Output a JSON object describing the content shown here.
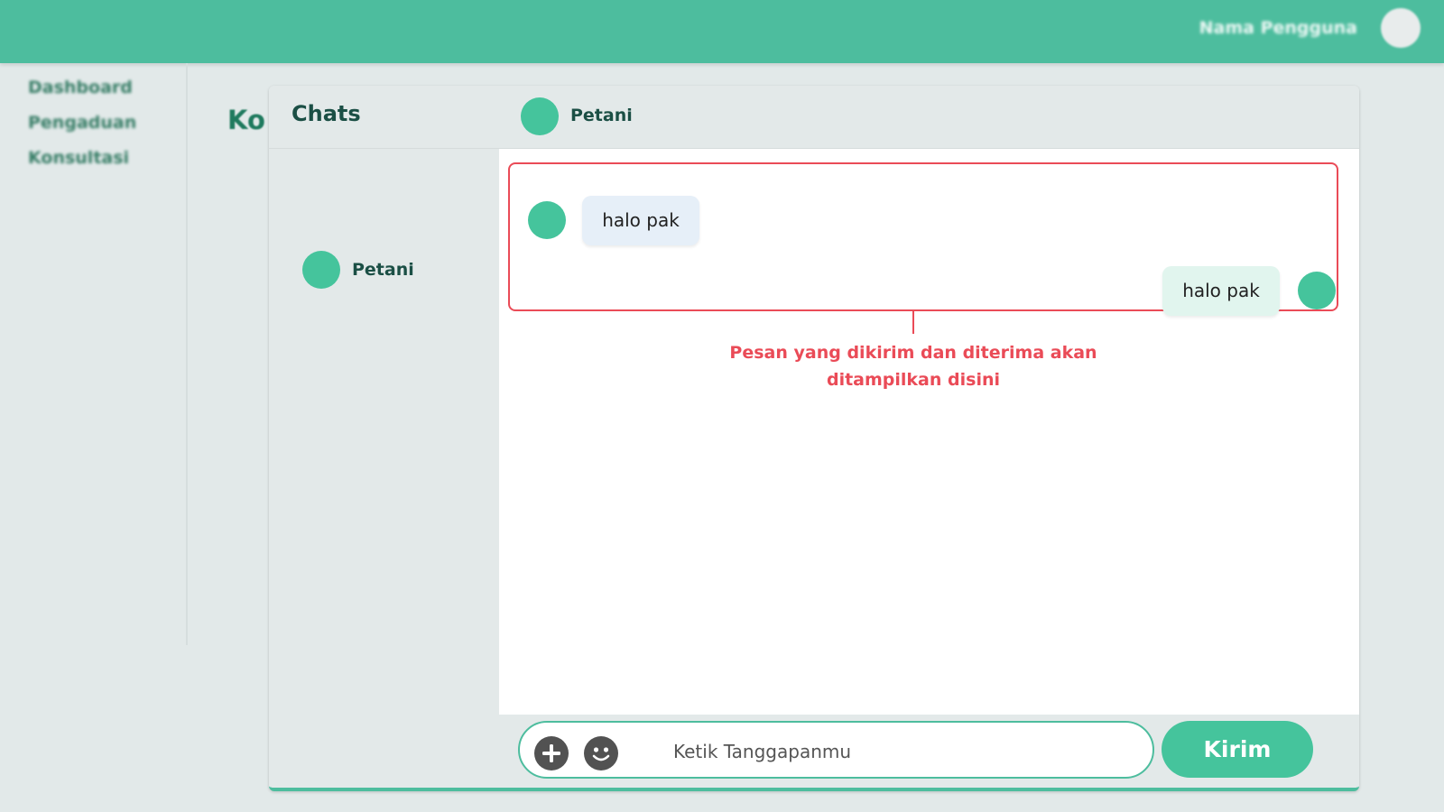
{
  "topbar": {
    "username": "Nama Pengguna"
  },
  "sidebar": {
    "items": [
      {
        "label": "Dashboard"
      },
      {
        "label": "Pengaduan"
      },
      {
        "label": "Konsultasi"
      }
    ]
  },
  "page": {
    "heading": "Konsultasi"
  },
  "chat": {
    "title": "Chats",
    "active_contact": "Petani",
    "contacts": [
      {
        "name": "Petani"
      }
    ],
    "messages": [
      {
        "direction": "incoming",
        "text": "halo pak"
      },
      {
        "direction": "outgoing",
        "text": "halo pak"
      }
    ],
    "annotation": "Pesan yang dikirim dan diterima akan ditampilkan disini",
    "input": {
      "placeholder": "Ketik Tanggapanmu",
      "value": ""
    },
    "send_label": "Kirim",
    "icons": {
      "attach": "plus-circle-icon",
      "emoji": "smile-icon"
    }
  },
  "colors": {
    "primary": "#4dbd9e",
    "avatar": "#45c49c",
    "annotation": "#ea4b57",
    "incoming_bubble": "#e6eff8",
    "outgoing_bubble": "#e1f5ee",
    "background": "#e2e9e9"
  }
}
